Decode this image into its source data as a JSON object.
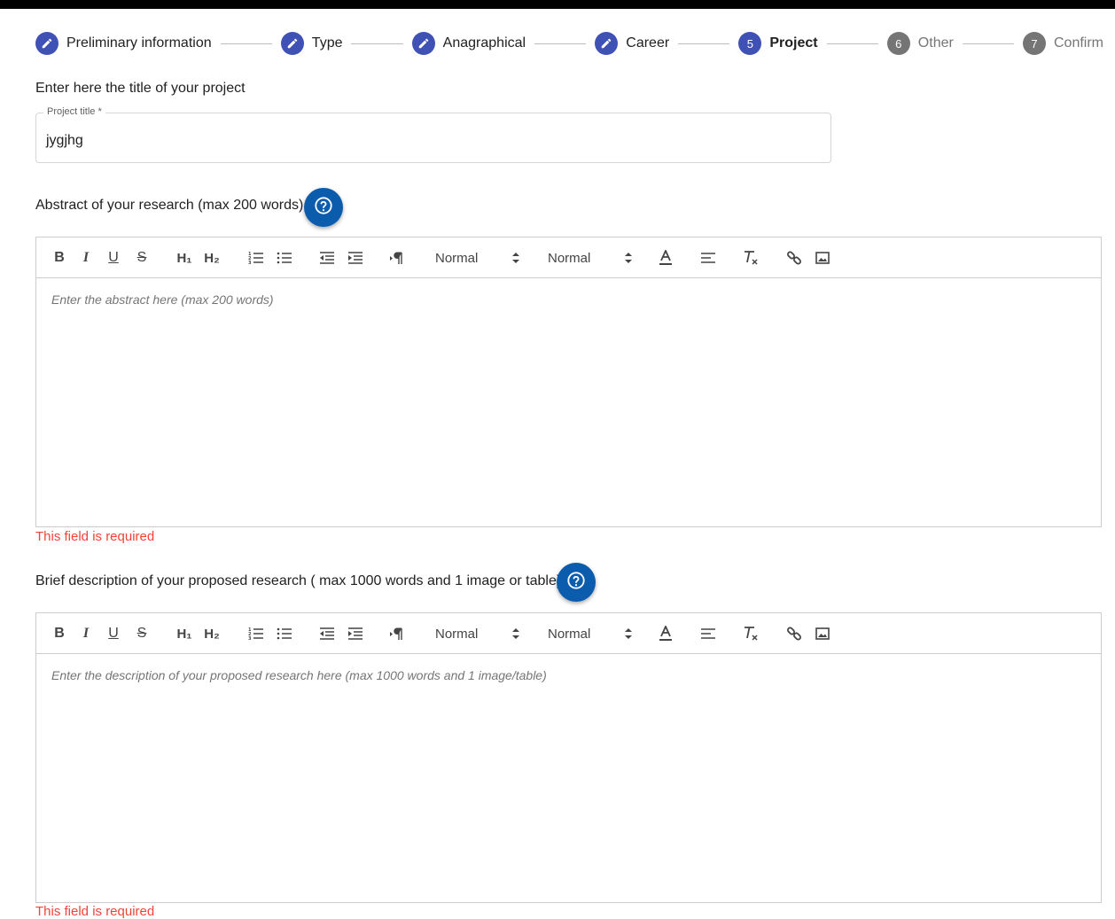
{
  "stepper": {
    "steps": [
      {
        "label": "Preliminary information",
        "state": "done",
        "icon": "pencil-icon"
      },
      {
        "label": "Type",
        "state": "done",
        "icon": "pencil-icon"
      },
      {
        "label": "Anagraphical",
        "state": "done",
        "icon": "pencil-icon"
      },
      {
        "label": "Career",
        "state": "done",
        "icon": "pencil-icon"
      },
      {
        "label": "Project",
        "state": "active",
        "number": "5"
      },
      {
        "label": "Other",
        "state": "pending",
        "number": "6"
      },
      {
        "label": "Confirm",
        "state": "pending",
        "number": "7"
      }
    ],
    "active_color": "#3f51b5",
    "pending_color": "#757575"
  },
  "project_title": {
    "prompt": "Enter here the title of your project",
    "label": "Project title *",
    "value": "jygjhg"
  },
  "abstract": {
    "label": "Abstract of your research (max 200 words)",
    "placeholder": "Enter the abstract here (max 200 words)",
    "error": "This field is required",
    "help_icon": "question-circle-icon"
  },
  "description": {
    "label": "Brief description of your proposed research ( max 1000 words and 1 image or table)",
    "placeholder": "Enter the description of your proposed research here (max 1000 words and 1 image/table)",
    "error": "This field is required",
    "help_icon": "question-circle-icon"
  },
  "toolbar": {
    "bold": "B",
    "italic": "I",
    "underline": "U",
    "strike": "S",
    "h1": "H₁",
    "h2": "H₂",
    "size_picker": "Normal",
    "header_picker": "Normal"
  },
  "colors": {
    "help_button": "#0b5cad",
    "error": "#f44336"
  }
}
